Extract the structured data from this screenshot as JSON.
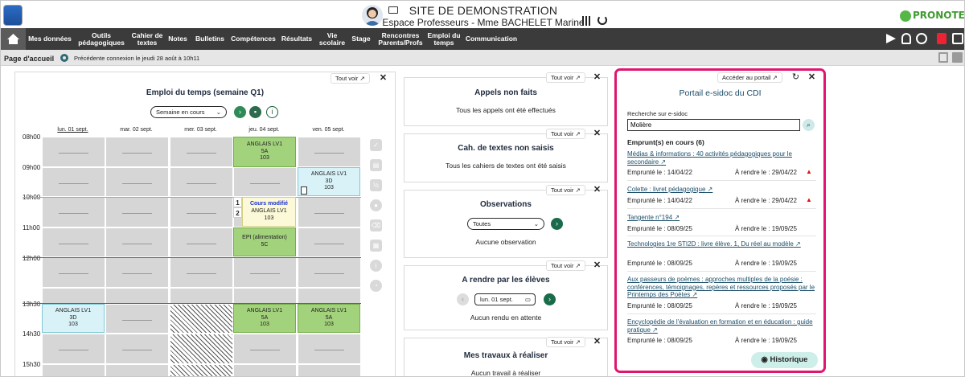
{
  "header": {
    "site_title": "SITE DE DEMONSTRATION",
    "subtitle": "Espace Professeurs - Mme BACHELET Marine",
    "brand": "PRONOTE"
  },
  "nav": [
    "Mes données",
    "Outils pédagogiques",
    "Cahier de textes",
    "Notes",
    "Bulletins",
    "Compétences",
    "Résultats",
    "Vie scolaire",
    "Stage",
    "Rencontres Parents/Profs",
    "Emploi du temps",
    "Communication"
  ],
  "subbar": {
    "page": "Page d'accueil",
    "last_connection": "Précédente connexion le jeudi 28 août à 10h11"
  },
  "common": {
    "tout_voir": "Tout voir",
    "close": "✕"
  },
  "timetable": {
    "title": "Emploi du temps (semaine Q1)",
    "week_select": "Semaine en cours",
    "days": [
      "lun. 01 sept.",
      "mar. 02 sept.",
      "mer. 03 sept.",
      "jeu. 04 sept.",
      "ven. 05 sept."
    ],
    "times": [
      "08h00",
      "09h00",
      "10h00",
      "11h00",
      "12h00",
      "13h30",
      "14h30",
      "15h30"
    ],
    "courses": [
      {
        "subject": "ANGLAIS LV1",
        "group": "5A",
        "room": "103"
      },
      {
        "subject": "ANGLAIS LV1",
        "group": "3D",
        "room": "103"
      },
      {
        "status": "Cours modifié",
        "subject": "ANGLAIS LV1",
        "room": "103",
        "num1": "1",
        "num2": "2"
      },
      {
        "subject": "EPI (alimentation)",
        "group": "5C"
      },
      {
        "subject": "ANGLAIS LV1",
        "group": "3D",
        "room": "103"
      },
      {
        "subject": "ANGLAIS LV1",
        "group": "5A",
        "room": "103"
      },
      {
        "subject": "ANGLAIS LV1",
        "group": "5A",
        "room": "103"
      }
    ]
  },
  "appels": {
    "title": "Appels non faits",
    "text": "Tous les appels ont été effectués"
  },
  "cahier": {
    "title": "Cah. de textes non saisis",
    "text": "Tous les cahiers de textes ont été saisis"
  },
  "observations": {
    "title": "Observations",
    "select": "Toutes",
    "text": "Aucune observation"
  },
  "a_rendre": {
    "title": "A rendre par les élèves",
    "date": "lun. 01 sept.",
    "text": "Aucun rendu en attente"
  },
  "travaux": {
    "title": "Mes travaux à réaliser",
    "text": "Aucun travail à réaliser"
  },
  "portal": {
    "access": "Accéder au portail",
    "title": "Portail e-sidoc du CDI",
    "search_label": "Recherche sur e-sidoc",
    "search_value": "Molière",
    "loans_header": "Emprunt(s) en cours (6)",
    "loans": [
      {
        "title": "Médias & informations : 40 activités pédagogiques pour le secondaire",
        "borrowed": "Emprunté le : 14/04/22",
        "due": "À rendre le : 29/04/22"
      },
      {
        "title": "Colette : livret pédagogique",
        "borrowed": "Emprunté le : 14/04/22",
        "due": "À rendre le : 29/04/22"
      },
      {
        "title": "Tangente n°194",
        "borrowed": "Emprunté le : 08/09/25",
        "due": "À rendre le : 19/09/25"
      },
      {
        "title": "Technologies 1re STI2D : livre élève. 1, Du réel au modèle",
        "borrowed": "Emprunté le : 08/09/25",
        "due": "À rendre le : 19/09/25"
      },
      {
        "title": "Aux passeurs de poèmes : approches multiples de la poésie : conférences, témoignages, repères et ressources proposés par le Printemps des Poètes",
        "borrowed": "Emprunté le : 08/09/25",
        "due": "À rendre le : 19/09/25"
      },
      {
        "title": "Encyclopédie de l'évaluation en formation et en éducation : guide pratique",
        "borrowed": "Emprunté le : 08/09/25",
        "due": "À rendre le : 19/09/25"
      }
    ],
    "history_button": "Historique"
  },
  "colors": {
    "nav_bg": "#3b3b3b",
    "course_green": "#a3d27c",
    "course_cyan": "#d8f2f7",
    "highlight": "#e0156f",
    "brand_green": "#3f9a2f"
  }
}
